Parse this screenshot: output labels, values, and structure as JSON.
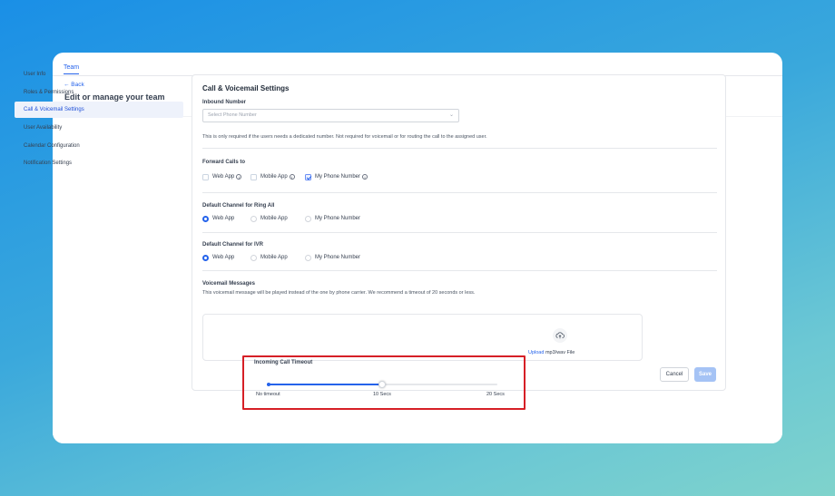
{
  "header": {
    "tab_label": "Team",
    "back_label": "← Back",
    "page_title": "Edit or manage your team"
  },
  "sidebar": {
    "items": [
      {
        "label": "User Info"
      },
      {
        "label": "Roles & Permissions"
      },
      {
        "label": "Call & Voicemail Settings",
        "active": true
      },
      {
        "label": "User Availability"
      },
      {
        "label": "Calendar Configuration"
      },
      {
        "label": "Notification Settings"
      }
    ]
  },
  "settings": {
    "title": "Call & Voicemail Settings",
    "inbound_number": {
      "label": "Inbound Number",
      "placeholder": "Select Phone Number",
      "helper": "This is only required if the users needs a dedicated number. Not required for voicemail or for routing the call to the assigned user."
    },
    "forward_calls": {
      "label": "Forward Calls to",
      "options": [
        {
          "label": "Web App",
          "checked": false
        },
        {
          "label": "Mobile App",
          "checked": false
        },
        {
          "label": "My Phone Number",
          "checked": true
        }
      ]
    },
    "ring_all": {
      "label": "Default Channel for Ring All",
      "options": [
        {
          "label": "Web App",
          "selected": true
        },
        {
          "label": "Mobile App",
          "selected": false
        },
        {
          "label": "My Phone Number",
          "selected": false
        }
      ]
    },
    "ivr": {
      "label": "Default Channel for IVR",
      "options": [
        {
          "label": "Web App",
          "selected": true
        },
        {
          "label": "Mobile App",
          "selected": false
        },
        {
          "label": "My Phone Number",
          "selected": false
        }
      ]
    },
    "voicemail": {
      "label": "Voicemail Messages",
      "helper": "This voicemail message will be played instead of the one by phone carrier. We recommend a timeout of 20 seconds or less."
    },
    "incoming_timeout": {
      "label": "Incoming Call Timeout",
      "min_label": "No timeout",
      "mid_label": "10 Secs",
      "max_label": "20 Secs",
      "value_seconds": 10,
      "max_seconds": 20
    },
    "upload": {
      "link_label": "Upload",
      "text": " mp3/wav File"
    }
  },
  "footer": {
    "cancel_label": "Cancel",
    "save_label": "Save"
  },
  "colors": {
    "accent": "#2563eb",
    "highlight": "#d61f26",
    "save_disabled": "#a5c3f5"
  }
}
